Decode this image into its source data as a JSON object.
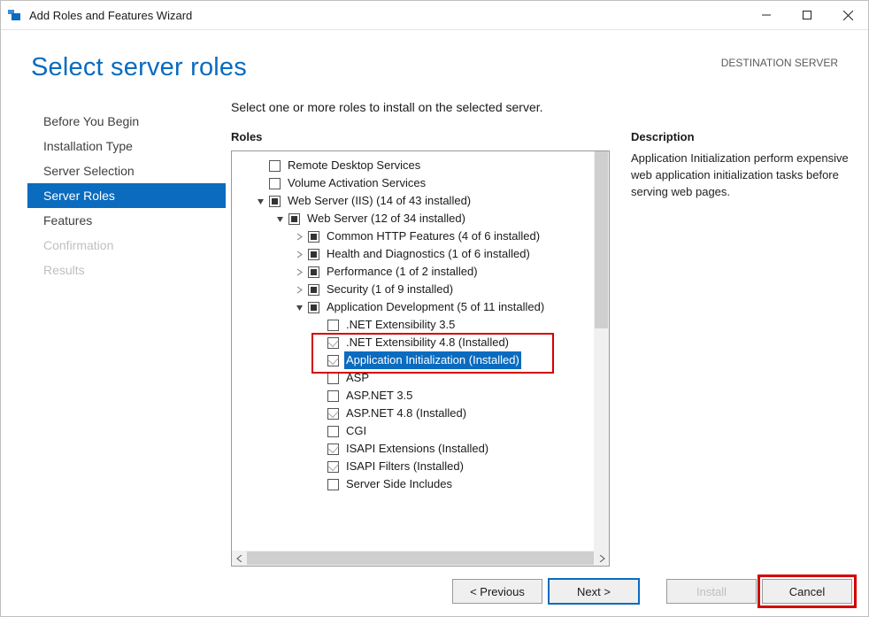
{
  "window": {
    "title": "Add Roles and Features Wizard"
  },
  "header": {
    "title": "Select server roles",
    "dest_label": "DESTINATION SERVER"
  },
  "sidebar": {
    "items": [
      {
        "label": "Before You Begin",
        "state": "normal"
      },
      {
        "label": "Installation Type",
        "state": "normal"
      },
      {
        "label": "Server Selection",
        "state": "normal"
      },
      {
        "label": "Server Roles",
        "state": "active"
      },
      {
        "label": "Features",
        "state": "normal"
      },
      {
        "label": "Confirmation",
        "state": "disabled"
      },
      {
        "label": "Results",
        "state": "disabled"
      }
    ]
  },
  "main": {
    "instruction": "Select one or more roles to install on the selected server.",
    "roles_label": "Roles",
    "description_label": "Description",
    "description_text": "Application Initialization perform expensive web application initialization tasks before serving web pages."
  },
  "tree": [
    {
      "indent": 0,
      "expander": "",
      "check": "empty",
      "label": "Remote Desktop Services"
    },
    {
      "indent": 0,
      "expander": "",
      "check": "empty",
      "label": "Volume Activation Services"
    },
    {
      "indent": 0,
      "expander": "down",
      "check": "partial",
      "label": "Web Server (IIS) (14 of 43 installed)"
    },
    {
      "indent": 1,
      "expander": "down",
      "check": "partial",
      "label": "Web Server (12 of 34 installed)"
    },
    {
      "indent": 2,
      "expander": "right",
      "check": "partial",
      "label": "Common HTTP Features (4 of 6 installed)"
    },
    {
      "indent": 2,
      "expander": "right",
      "check": "partial",
      "label": "Health and Diagnostics (1 of 6 installed)"
    },
    {
      "indent": 2,
      "expander": "right",
      "check": "partial",
      "label": "Performance (1 of 2 installed)"
    },
    {
      "indent": 2,
      "expander": "right",
      "check": "partial",
      "label": "Security (1 of 9 installed)"
    },
    {
      "indent": 2,
      "expander": "down",
      "check": "partial",
      "label": "Application Development (5 of 11 installed)"
    },
    {
      "indent": 3,
      "expander": "",
      "check": "empty",
      "label": ".NET Extensibility 3.5"
    },
    {
      "indent": 3,
      "expander": "",
      "check": "checked-dim",
      "label": ".NET Extensibility 4.8 (Installed)"
    },
    {
      "indent": 3,
      "expander": "",
      "check": "checked-dim",
      "label": "Application Initialization (Installed)",
      "selected": true
    },
    {
      "indent": 3,
      "expander": "",
      "check": "empty",
      "label": "ASP"
    },
    {
      "indent": 3,
      "expander": "",
      "check": "empty",
      "label": "ASP.NET 3.5"
    },
    {
      "indent": 3,
      "expander": "",
      "check": "checked-dim",
      "label": "ASP.NET 4.8 (Installed)"
    },
    {
      "indent": 3,
      "expander": "",
      "check": "empty",
      "label": "CGI"
    },
    {
      "indent": 3,
      "expander": "",
      "check": "checked-dim",
      "label": "ISAPI Extensions (Installed)"
    },
    {
      "indent": 3,
      "expander": "",
      "check": "checked-dim",
      "label": "ISAPI Filters (Installed)"
    },
    {
      "indent": 3,
      "expander": "",
      "check": "empty",
      "label": "Server Side Includes"
    }
  ],
  "footer": {
    "previous": "< Previous",
    "next": "Next >",
    "install": "Install",
    "cancel": "Cancel"
  }
}
